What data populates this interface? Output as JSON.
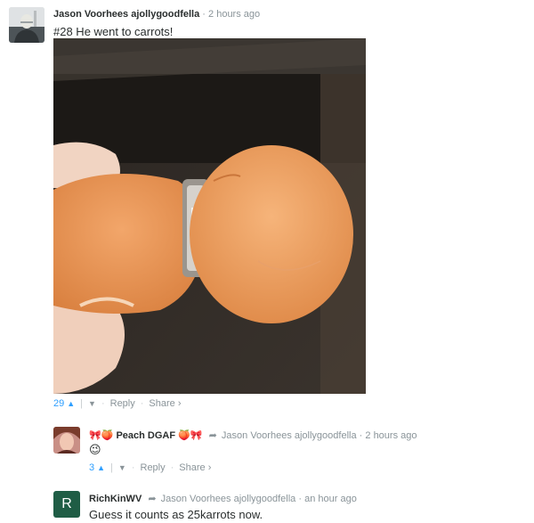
{
  "comments": [
    {
      "author": "Jason Voorhees ajollygoodfella",
      "time": "2 hours ago",
      "text": "#28 He went to carrots!",
      "votes": "29",
      "reply_label": "Reply",
      "share_label": "Share ›",
      "image_alt": "Carrot grown through a diamond ring"
    },
    {
      "author": "Peach DGAF",
      "reply_to": "Jason Voorhees ajollygoodfella",
      "time": "2 hours ago",
      "text": "😉",
      "votes": "3",
      "reply_label": "Reply",
      "share_label": "Share ›"
    },
    {
      "author": "RichKinWV",
      "avatar_letter": "R",
      "reply_to": "Jason Voorhees ajollygoodfella",
      "time": "an hour ago",
      "text": "Guess it counts as 25karrots now."
    }
  ],
  "colors": {
    "link_blue": "#2e9fff",
    "muted": "#8a9499",
    "avatar_green": "#1f5d45"
  }
}
